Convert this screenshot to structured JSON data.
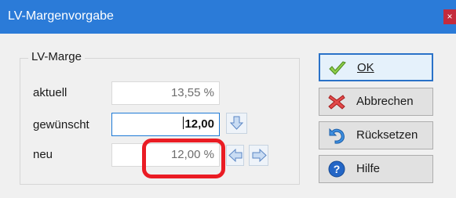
{
  "window": {
    "title": "LV-Margenvorgabe",
    "close_glyph": "×"
  },
  "group": {
    "legend": "LV-Marge"
  },
  "rows": {
    "aktuell": {
      "label": "aktuell",
      "value": "13,55 %"
    },
    "gewuenscht": {
      "label": "gewünscht",
      "value": "12,00"
    },
    "neu": {
      "label": "neu",
      "value": "12,00 %"
    }
  },
  "buttons": {
    "ok": {
      "label": "OK",
      "icon": "checkmark-icon"
    },
    "cancel": {
      "label": "Abbrechen",
      "icon": "red-x-icon"
    },
    "reset": {
      "label": "Rücksetzen",
      "icon": "undo-arrow-icon"
    },
    "help": {
      "label": "Hilfe",
      "icon": "help-icon"
    }
  },
  "colors": {
    "titlebar": "#2b7bd8",
    "highlight": "#ea1c24",
    "close": "#c42b3c"
  }
}
